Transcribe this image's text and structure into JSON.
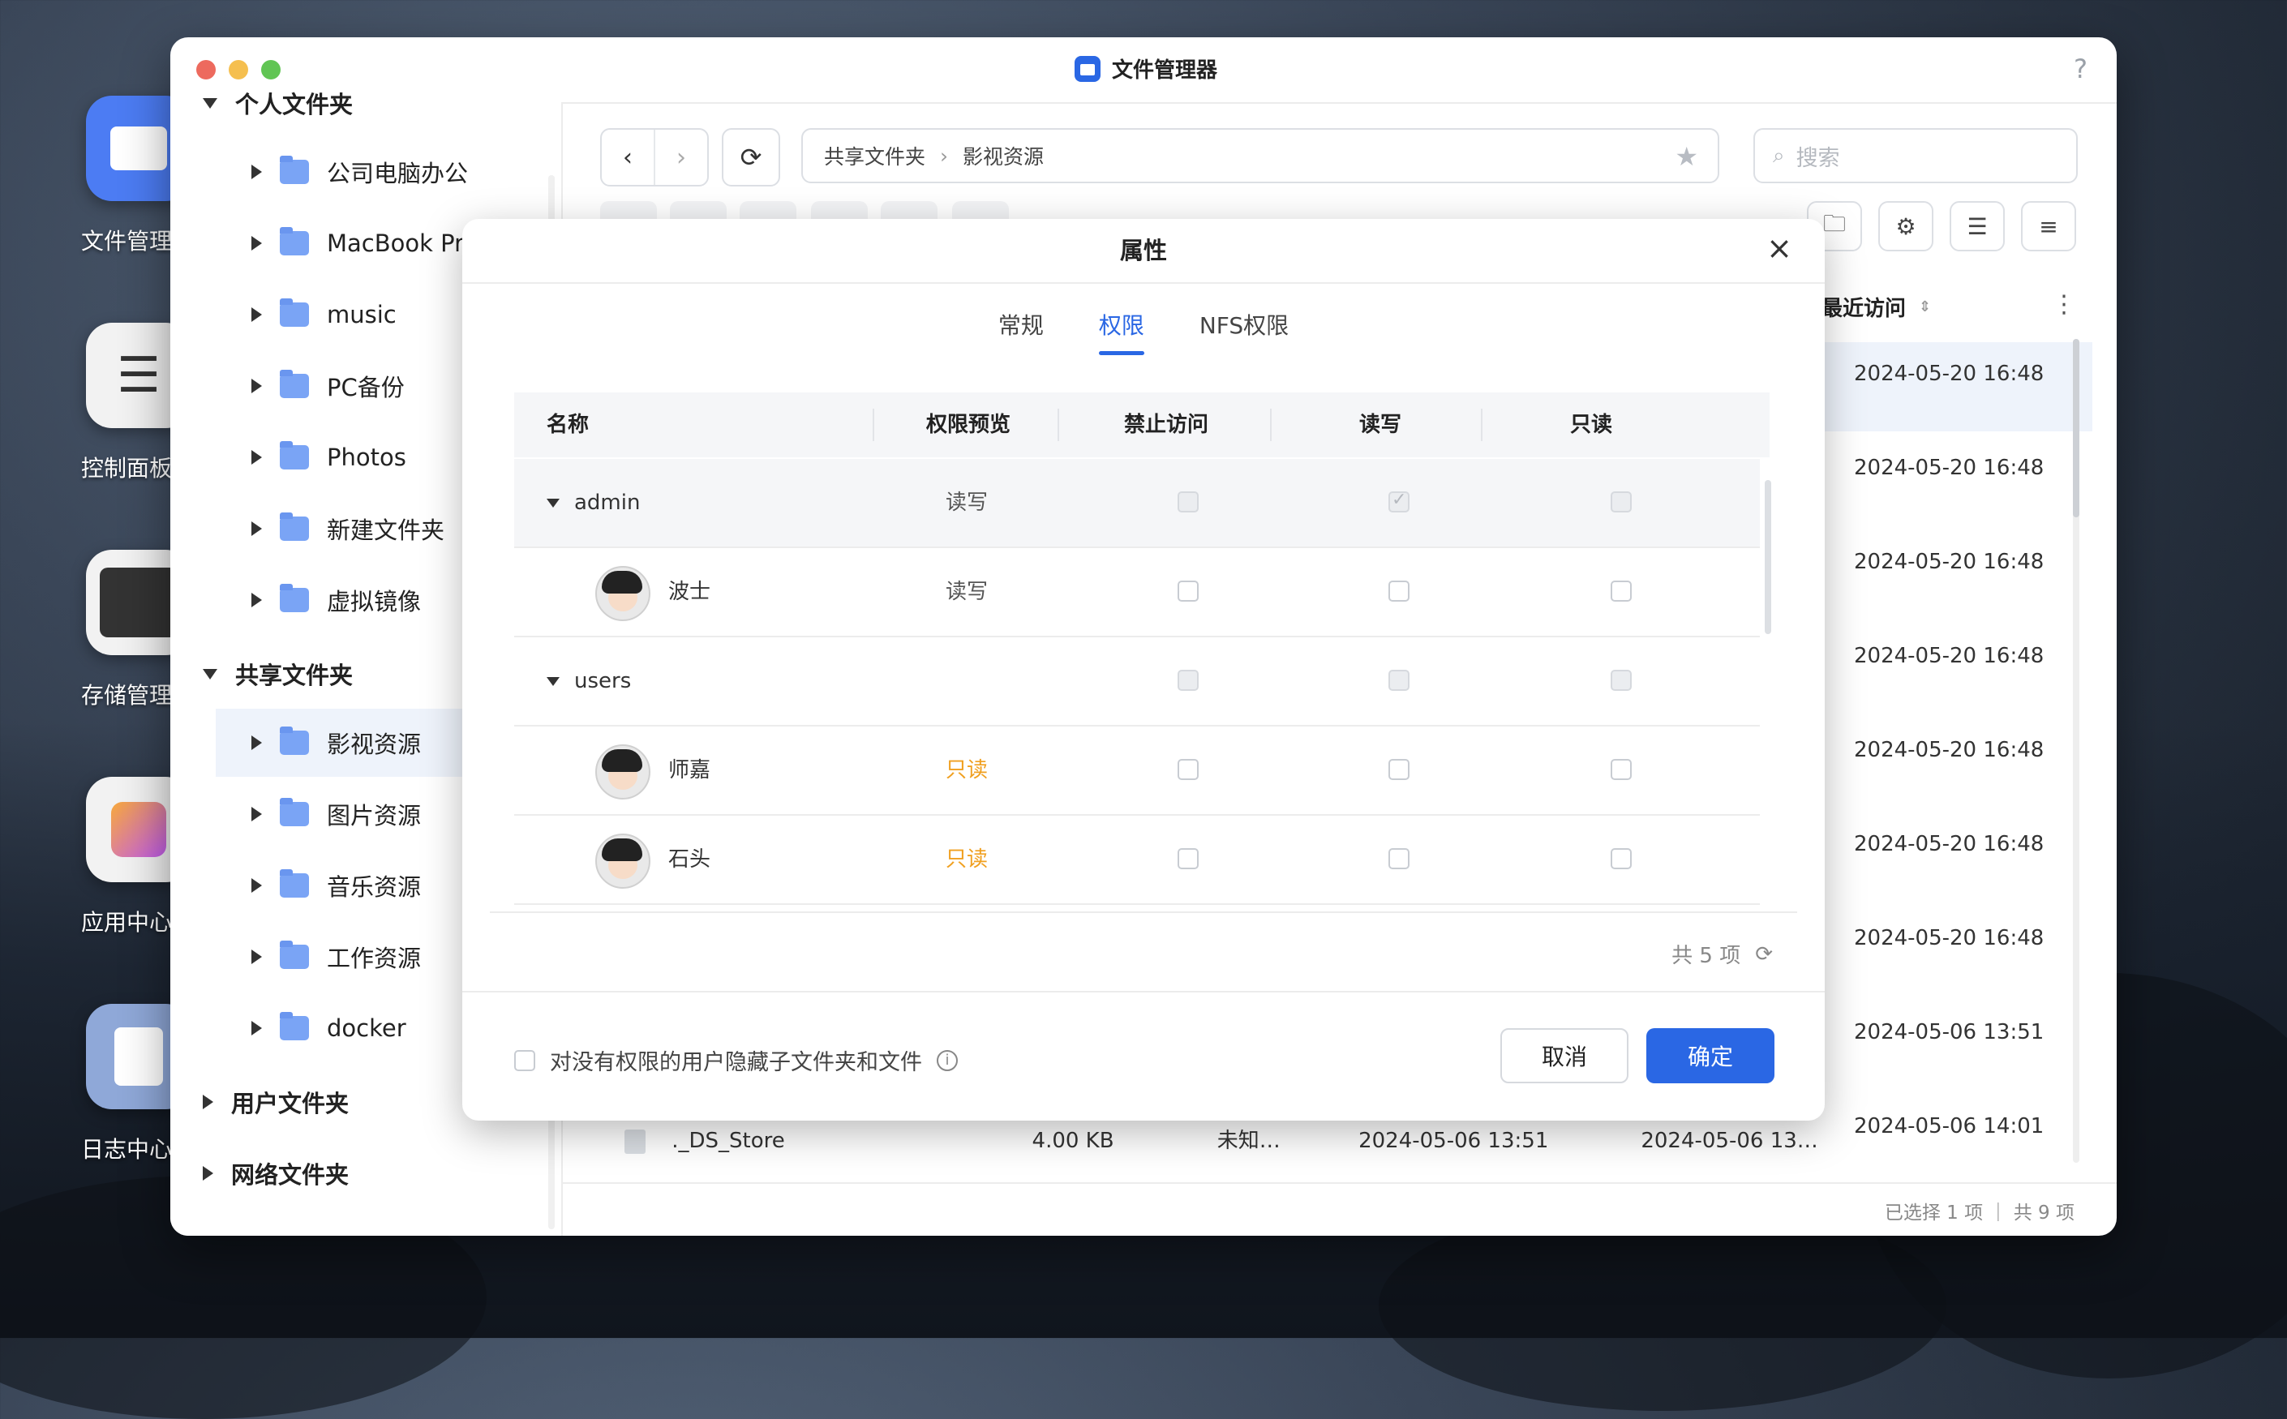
{
  "desktop": {
    "icons": [
      {
        "label": "文件管理",
        "icon": "folder-app-icon"
      },
      {
        "label": "控制面板",
        "icon": "sliders-icon"
      },
      {
        "label": "存储管理",
        "icon": "storage-icon"
      },
      {
        "label": "应用中心",
        "icon": "app-center-icon"
      },
      {
        "label": "日志中心",
        "icon": "log-center-icon"
      }
    ]
  },
  "window": {
    "title": "文件管理器",
    "help": "?",
    "colors": {
      "accent": "#2a67e4",
      "readonly": "#f0a020",
      "close": "#ed6a5e",
      "minimize": "#f5bf4f",
      "maximize": "#61c554"
    }
  },
  "sidebar": {
    "groups": [
      {
        "label": "个人文件夹",
        "items": [
          "公司电脑办公",
          "MacBook Pro",
          "music",
          "PC备份",
          "Photos",
          "新建文件夹",
          "虚拟镜像"
        ]
      },
      {
        "label": "共享文件夹",
        "items": [
          "影视资源",
          "图片资源",
          "音乐资源",
          "工作资源",
          "docker"
        ]
      },
      {
        "label": "用户文件夹",
        "items": []
      },
      {
        "label": "网络文件夹",
        "items": []
      }
    ],
    "selected": "影视资源"
  },
  "toolbar": {
    "back": "‹",
    "forward": "›",
    "refresh": "⟳",
    "breadcrumb": [
      "共享文件夹",
      "影视资源"
    ],
    "breadcrumb_sep": "›",
    "search_placeholder": "搜索"
  },
  "filelist": {
    "last_access_header": "最近访问",
    "dates": [
      "2024-05-20 16:48",
      "2024-05-20 16:48",
      "2024-05-20 16:48",
      "2024-05-20 16:48",
      "2024-05-20 16:48",
      "2024-05-20 16:48",
      "2024-05-20 16:48",
      "2024-05-06 13:51",
      "2024-05-06 14:01"
    ],
    "visible_row": {
      "name": "._DS_Store",
      "size": "4.00 KB",
      "type": "未知…",
      "created": "2024-05-06 13:51",
      "modified": "2024-05-06 13…"
    },
    "status": "已选择 1 项 ｜ 共 9 项"
  },
  "dialog": {
    "title": "属性",
    "close": "×",
    "tabs": [
      "常规",
      "权限",
      "NFS权限"
    ],
    "active_tab": "权限",
    "columns": [
      "名称",
      "权限预览",
      "禁止访问",
      "读写",
      "只读"
    ],
    "rows": [
      {
        "kind": "group",
        "name": "admin",
        "preview": "读写",
        "deny": false,
        "rw": true,
        "ro": false,
        "disabled": true
      },
      {
        "kind": "user",
        "name": "波士",
        "preview": "读写",
        "deny": false,
        "rw": false,
        "ro": false,
        "disabled": false
      },
      {
        "kind": "group",
        "name": "users",
        "preview": "",
        "deny": false,
        "rw": false,
        "ro": false,
        "disabled": true
      },
      {
        "kind": "user",
        "name": "师嘉",
        "preview": "只读",
        "deny": false,
        "rw": false,
        "ro": false,
        "disabled": false
      },
      {
        "kind": "user",
        "name": "石头",
        "preview": "只读",
        "deny": false,
        "rw": false,
        "ro": false,
        "disabled": false
      }
    ],
    "count": "共 5 项",
    "hide_option": "对没有权限的用户隐藏子文件夹和文件",
    "cancel": "取消",
    "ok": "确定"
  }
}
